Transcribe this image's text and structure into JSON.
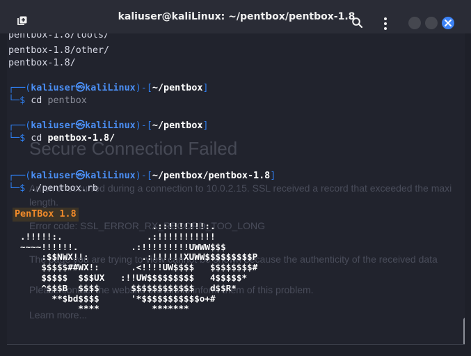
{
  "window": {
    "title": "kaliuser@kaliLinux: ~/pentbox/pentbox-1.8",
    "icons": [
      "new-tab-icon",
      "search-icon",
      "kebab-menu-icon",
      "minimize-icon",
      "maximize-icon",
      "close-icon"
    ],
    "accent": "#3b82f6"
  },
  "terminal": {
    "prompt_colors": {
      "bracket": "#2f7ff0",
      "user": "#4b8ff5",
      "path": "#ffffff"
    },
    "listing": [
      "pentbox-1.8/tools/",
      "pentbox-1.8/other/",
      "pentbox-1.8/"
    ],
    "sessions": [
      {
        "prompt_prefix": "┌──(",
        "user": "kaliuser",
        "at": "㉿",
        "host": "kaliLinux",
        "mid": ")-[",
        "path": "~/pentbox",
        "suffix": "]",
        "cmd_prefix": "└─$ ",
        "command": "cd",
        "argument": "pentbox"
      },
      {
        "prompt_prefix": "┌──(",
        "user": "kaliuser",
        "at": "㉿",
        "host": "kaliLinux",
        "mid": ")-[",
        "path": "~/pentbox",
        "suffix": "]",
        "cmd_prefix": "└─$ ",
        "command": "cd",
        "argument": "pentbox-1.8/"
      },
      {
        "prompt_prefix": "┌──(",
        "user": "kaliuser",
        "at": "㉿",
        "host": "kaliLinux",
        "mid": ")-[",
        "path": "~/pentbox/pentbox-1.8",
        "suffix": "]",
        "cmd_prefix": "└─$ ",
        "command": "./pentbox.rb",
        "argument": ""
      }
    ],
    "banner": "PenTBox 1.8",
    "ascii_art": "                         .::!!!!!!!:.\n.!!!!!:.                .:!!!!!!!!!!!\n~~~~!!!!!!.          .:!!!!!!!!!UWWW$$$\n    :$$NWX!!:          .:!!!!!!XUWW$$$$$$$$$P\n    $$$$$##WX!:      .<!!!!UW$$$$   $$$$$$$$#\n    $$$$$  $$$UX   :!!UW$$$$$$$$$   4$$$$$*\n    ^$$$B  $$$$      $$$$$$$$$$$$   d$$R*\n      **$bd$$$$      '*$$$$$$$$$$$o+#\n           ****          *******"
  },
  "background_overlay": {
    "heading": "Secure Connection Failed",
    "line1": "An error occurred during a connection to 10.0.2.15. SSL received a record that exceeded the maxi",
    "line2": "length.",
    "line3": "Error code: SSL_ERROR_RX_RECORD_TOO_LONG",
    "line4": "The page you are trying to view cannot be shown because the authenticity of the received data",
    "line5": "Please contact the website owners to inform them of this problem.",
    "line6": "Learn more..."
  }
}
